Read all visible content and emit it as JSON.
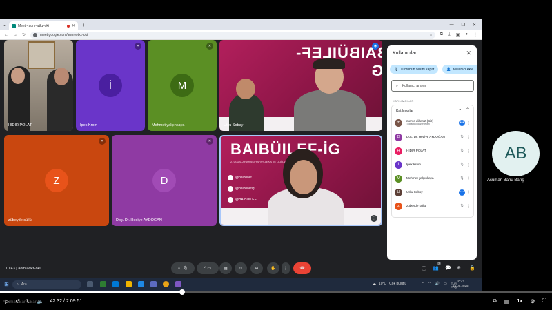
{
  "browser": {
    "tab_title": "Meet - aom-wtkz-oki",
    "new_tab": "+",
    "url": "meet.google.com/aom-wtkz-oki"
  },
  "meet": {
    "tiles": [
      {
        "name": "HIDIR POLAT"
      },
      {
        "name": "İpek Krom",
        "initial": "İ",
        "color": "#6a35c9",
        "avatar_color": "#4a1fa0"
      },
      {
        "name": "Mehmet yalçınkaya",
        "initial": "M",
        "color": "#5b8f24",
        "avatar_color": "#3d6b14"
      },
      {
        "name": "Utku Sobay"
      },
      {
        "name": "zübeyde süllü",
        "initial": "Z",
        "color": "#c9470f",
        "avatar_color": "#e8531a"
      },
      {
        "name": "Doç. Dr. Hediye AYDOĞAN",
        "initial": "D",
        "color": "#8f3aa3",
        "avatar_color": "#a14bb5"
      }
    ],
    "poster_brand": "BAIBÜILEF-İG",
    "poster_brand_short": "BAIBÜILEF-İG",
    "poster_sub": "2. ULUSLARARASI YAPAY ZEKA VE DİJİTAL",
    "poster_handles": [
      "@baibuilef",
      "@baibuilefig",
      "@BAIBUILEF"
    ],
    "clock": "10:43",
    "meeting_code": "aom-wtkz-oki",
    "participant_badge": "7"
  },
  "panel": {
    "title": "Kullanıcılar",
    "mute_all": "Tümünün sesini kapat",
    "add_user": "Kullanıcı ekle",
    "search_placeholder": "Kullanıcı arayın",
    "section": "KATILIMCILAR",
    "group_label": "Katılımcılar",
    "group_count": "7",
    "participants": [
      {
        "name": "merve dilteniz (Siz)",
        "role": "Toplantıyı düzenleyen",
        "initial": "m",
        "color": "#795548"
      },
      {
        "name": "Doç. Dr. Hediye AYDOĞAN",
        "initial": "D",
        "color": "#8f3aa3"
      },
      {
        "name": "HIDIR POLAT",
        "initial": "H",
        "color": "#e91e63"
      },
      {
        "name": "İpek Krom",
        "initial": "İ",
        "color": "#6a35c9"
      },
      {
        "name": "Mehmet yalçınkaya",
        "initial": "M",
        "color": "#5b8f24"
      },
      {
        "name": "Utku Sobay",
        "initial": "U",
        "color": "#5d4037"
      },
      {
        "name": "zübeyde süllü",
        "initial": "z",
        "color": "#e8531a"
      }
    ]
  },
  "side_user": {
    "initials": "AB",
    "name": "Asuman Banu Barış"
  },
  "taskbar": {
    "search": "Ara",
    "weather": "10°C",
    "weather_desc": "Çok bulutlu",
    "lang": "TUR",
    "lang2": "TRQ",
    "time": "10:43",
    "date": "14.05.2025"
  },
  "player": {
    "time": "42:32 / 2:09:51",
    "progress": 0.33,
    "speed": "1x",
    "watermark": "Asuman Banu Barış"
  }
}
